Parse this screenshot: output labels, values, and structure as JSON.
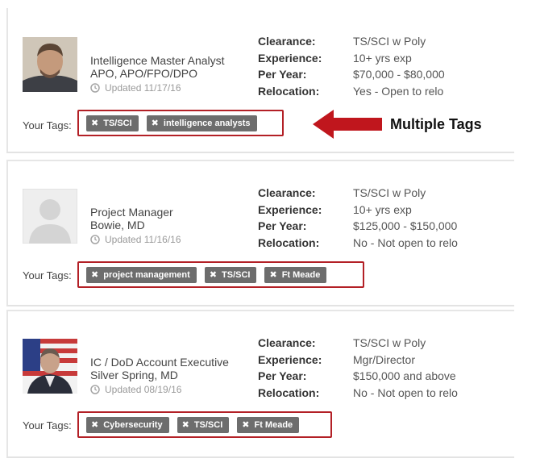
{
  "detail_labels": {
    "clearance": "Clearance:",
    "experience": "Experience:",
    "per_year": "Per Year:",
    "relocation": "Relocation:"
  },
  "tags_label": "Your Tags:",
  "annotation": {
    "text": "Multiple Tags",
    "color": "#c0161d"
  },
  "tag_remove_icon": "close-x-icon",
  "colors": {
    "tag_bg": "#6d6d6d",
    "highlight_box": "#b32026"
  },
  "candidates": [
    {
      "title": "Intelligence Master Analyst",
      "location": "APO, APO/FPO/DPO",
      "updated": "Updated 11/17/16",
      "clearance": "TS/SCI w Poly",
      "experience": "10+ yrs exp",
      "per_year": "$70,000 - $80,000",
      "relocation": "Yes - Open to relo",
      "tags": [
        "TS/SCI",
        "intelligence analysts"
      ]
    },
    {
      "title": "Project Manager",
      "location": "Bowie, MD",
      "updated": "Updated 11/16/16",
      "clearance": "TS/SCI w Poly",
      "experience": "10+ yrs exp",
      "per_year": "$125,000 - $150,000",
      "relocation": "No - Not open to relo",
      "tags": [
        "project management",
        "TS/SCI",
        "Ft Meade"
      ]
    },
    {
      "title": "IC / DoD Account Executive",
      "location": "Silver Spring, MD",
      "updated": "Updated 08/19/16",
      "clearance": "TS/SCI w Poly",
      "experience": "Mgr/Director",
      "per_year": "$150,000 and above",
      "relocation": "No - Not open to relo",
      "tags": [
        "Cybersecurity",
        "TS/SCI",
        "Ft Meade"
      ]
    }
  ]
}
